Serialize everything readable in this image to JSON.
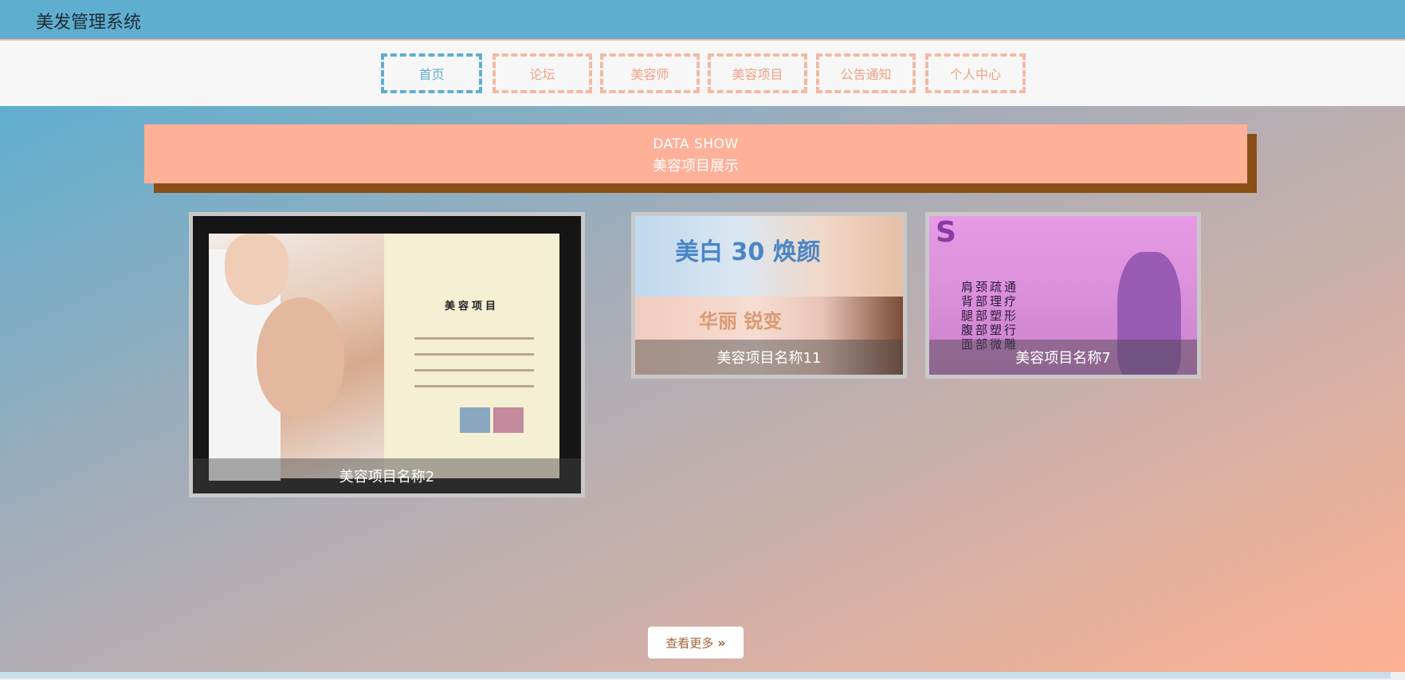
{
  "app": {
    "title": "美发管理系统"
  },
  "nav": {
    "items": [
      {
        "label": "首页",
        "active": true
      },
      {
        "label": "论坛"
      },
      {
        "label": "美容师"
      },
      {
        "label": "美容项目"
      },
      {
        "label": "公告通知"
      },
      {
        "label": "个人中心"
      }
    ]
  },
  "section": {
    "en_title": "DATA SHOW",
    "cn_title": "美容项目展示"
  },
  "cards": [
    {
      "caption": "美容项目名称2",
      "image_title": "美容项目"
    },
    {
      "caption": "美容项目名称11",
      "image_text_1": "美白 30 焕颜",
      "image_text_2": "华丽 锐变"
    },
    {
      "caption": "美容项目名称7",
      "image_text": [
        "肩颈疏通",
        "背部理疗",
        "腿部塑形",
        "腹部塑行",
        "面部微雕"
      ]
    }
  ],
  "more": {
    "label": "查看更多",
    "icon": "double-chevron-right-icon"
  },
  "colors": {
    "header": "#5faed0",
    "accent": "#ffb098",
    "nav_border": "#f3b9a2"
  }
}
